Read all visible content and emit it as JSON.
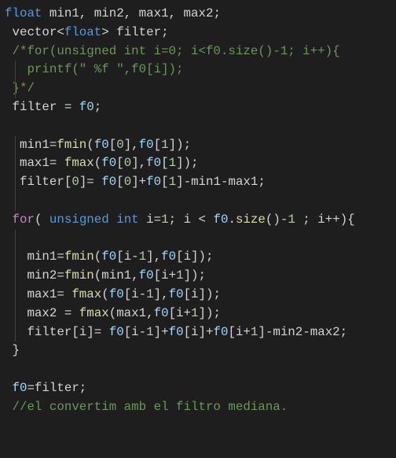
{
  "editor": {
    "lines": [
      [
        [
          "float",
          "kw"
        ],
        [
          " min1, min2, max1, max2;",
          "pl"
        ]
      ],
      [
        [
          " vector<",
          "pl"
        ],
        [
          "float",
          "kw"
        ],
        [
          "> filter;",
          "pl"
        ]
      ],
      [
        [
          " /*for(unsigned int i=0; i<f0.size()-1; i++){",
          "cm"
        ]
      ],
      [
        [
          "   printf(\" %f \",f0[i]);",
          "cm"
        ]
      ],
      [
        [
          " }*/",
          "cm"
        ]
      ],
      [
        [
          " filter = ",
          "pl"
        ],
        [
          "f0",
          "var"
        ],
        [
          ";",
          "pl"
        ]
      ],
      [],
      [
        [
          "  min1=",
          "pl"
        ],
        [
          "fmin",
          "fn"
        ],
        [
          "(",
          "pl"
        ],
        [
          "f0",
          "var"
        ],
        [
          "[",
          "pl"
        ],
        [
          "0",
          "num"
        ],
        [
          "],",
          "pl"
        ],
        [
          "f0",
          "var"
        ],
        [
          "[",
          "pl"
        ],
        [
          "1",
          "num"
        ],
        [
          "]);",
          "pl"
        ]
      ],
      [
        [
          "  max1= ",
          "pl"
        ],
        [
          "fmax",
          "fn"
        ],
        [
          "(",
          "pl"
        ],
        [
          "f0",
          "var"
        ],
        [
          "[",
          "pl"
        ],
        [
          "0",
          "num"
        ],
        [
          "],",
          "pl"
        ],
        [
          "f0",
          "var"
        ],
        [
          "[",
          "pl"
        ],
        [
          "1",
          "num"
        ],
        [
          "]);",
          "pl"
        ]
      ],
      [
        [
          "  filter[",
          "pl"
        ],
        [
          "0",
          "num"
        ],
        [
          "]= ",
          "pl"
        ],
        [
          "f0",
          "var"
        ],
        [
          "[",
          "pl"
        ],
        [
          "0",
          "num"
        ],
        [
          "]+",
          "pl"
        ],
        [
          "f0",
          "var"
        ],
        [
          "[",
          "pl"
        ],
        [
          "1",
          "num"
        ],
        [
          "]-min1-max1;",
          "pl"
        ]
      ],
      [],
      [
        [
          " ",
          "pl"
        ],
        [
          "for",
          "ctl"
        ],
        [
          "( ",
          "pl"
        ],
        [
          "unsigned int",
          "kw"
        ],
        [
          " i=",
          "pl"
        ],
        [
          "1",
          "num"
        ],
        [
          "; i < ",
          "pl"
        ],
        [
          "f0",
          "var"
        ],
        [
          ".",
          "pl"
        ],
        [
          "size",
          "fn"
        ],
        [
          "()-",
          "pl"
        ],
        [
          "1",
          "num"
        ],
        [
          " ; i++){",
          "pl"
        ]
      ],
      [],
      [
        [
          "   min1=",
          "pl"
        ],
        [
          "fmin",
          "fn"
        ],
        [
          "(",
          "pl"
        ],
        [
          "f0",
          "var"
        ],
        [
          "[i-",
          "pl"
        ],
        [
          "1",
          "num"
        ],
        [
          "],",
          "pl"
        ],
        [
          "f0",
          "var"
        ],
        [
          "[i]);",
          "pl"
        ]
      ],
      [
        [
          "   min2=",
          "pl"
        ],
        [
          "fmin",
          "fn"
        ],
        [
          "(min1,",
          "pl"
        ],
        [
          "f0",
          "var"
        ],
        [
          "[i+",
          "pl"
        ],
        [
          "1",
          "num"
        ],
        [
          "]);",
          "pl"
        ]
      ],
      [
        [
          "   max1= ",
          "pl"
        ],
        [
          "fmax",
          "fn"
        ],
        [
          "(",
          "pl"
        ],
        [
          "f0",
          "var"
        ],
        [
          "[i-",
          "pl"
        ],
        [
          "1",
          "num"
        ],
        [
          "],",
          "pl"
        ],
        [
          "f0",
          "var"
        ],
        [
          "[i]);",
          "pl"
        ]
      ],
      [
        [
          "   max2 = ",
          "pl"
        ],
        [
          "fmax",
          "fn"
        ],
        [
          "(max1,",
          "pl"
        ],
        [
          "f0",
          "var"
        ],
        [
          "[i+",
          "pl"
        ],
        [
          "1",
          "num"
        ],
        [
          "]);",
          "pl"
        ]
      ],
      [
        [
          "   filter[i]= ",
          "pl"
        ],
        [
          "f0",
          "var"
        ],
        [
          "[i-",
          "pl"
        ],
        [
          "1",
          "num"
        ],
        [
          "]+",
          "pl"
        ],
        [
          "f0",
          "var"
        ],
        [
          "[i]+",
          "pl"
        ],
        [
          "f0",
          "var"
        ],
        [
          "[i+",
          "pl"
        ],
        [
          "1",
          "num"
        ],
        [
          "]-min2-max2;",
          "pl"
        ]
      ],
      [
        [
          " }",
          "pl"
        ]
      ],
      [],
      [
        [
          " ",
          "pl"
        ],
        [
          "f0",
          "var"
        ],
        [
          "=filter;",
          "pl"
        ]
      ],
      [
        [
          " //el convertim amb el filtro mediana.",
          "cm"
        ]
      ]
    ]
  }
}
